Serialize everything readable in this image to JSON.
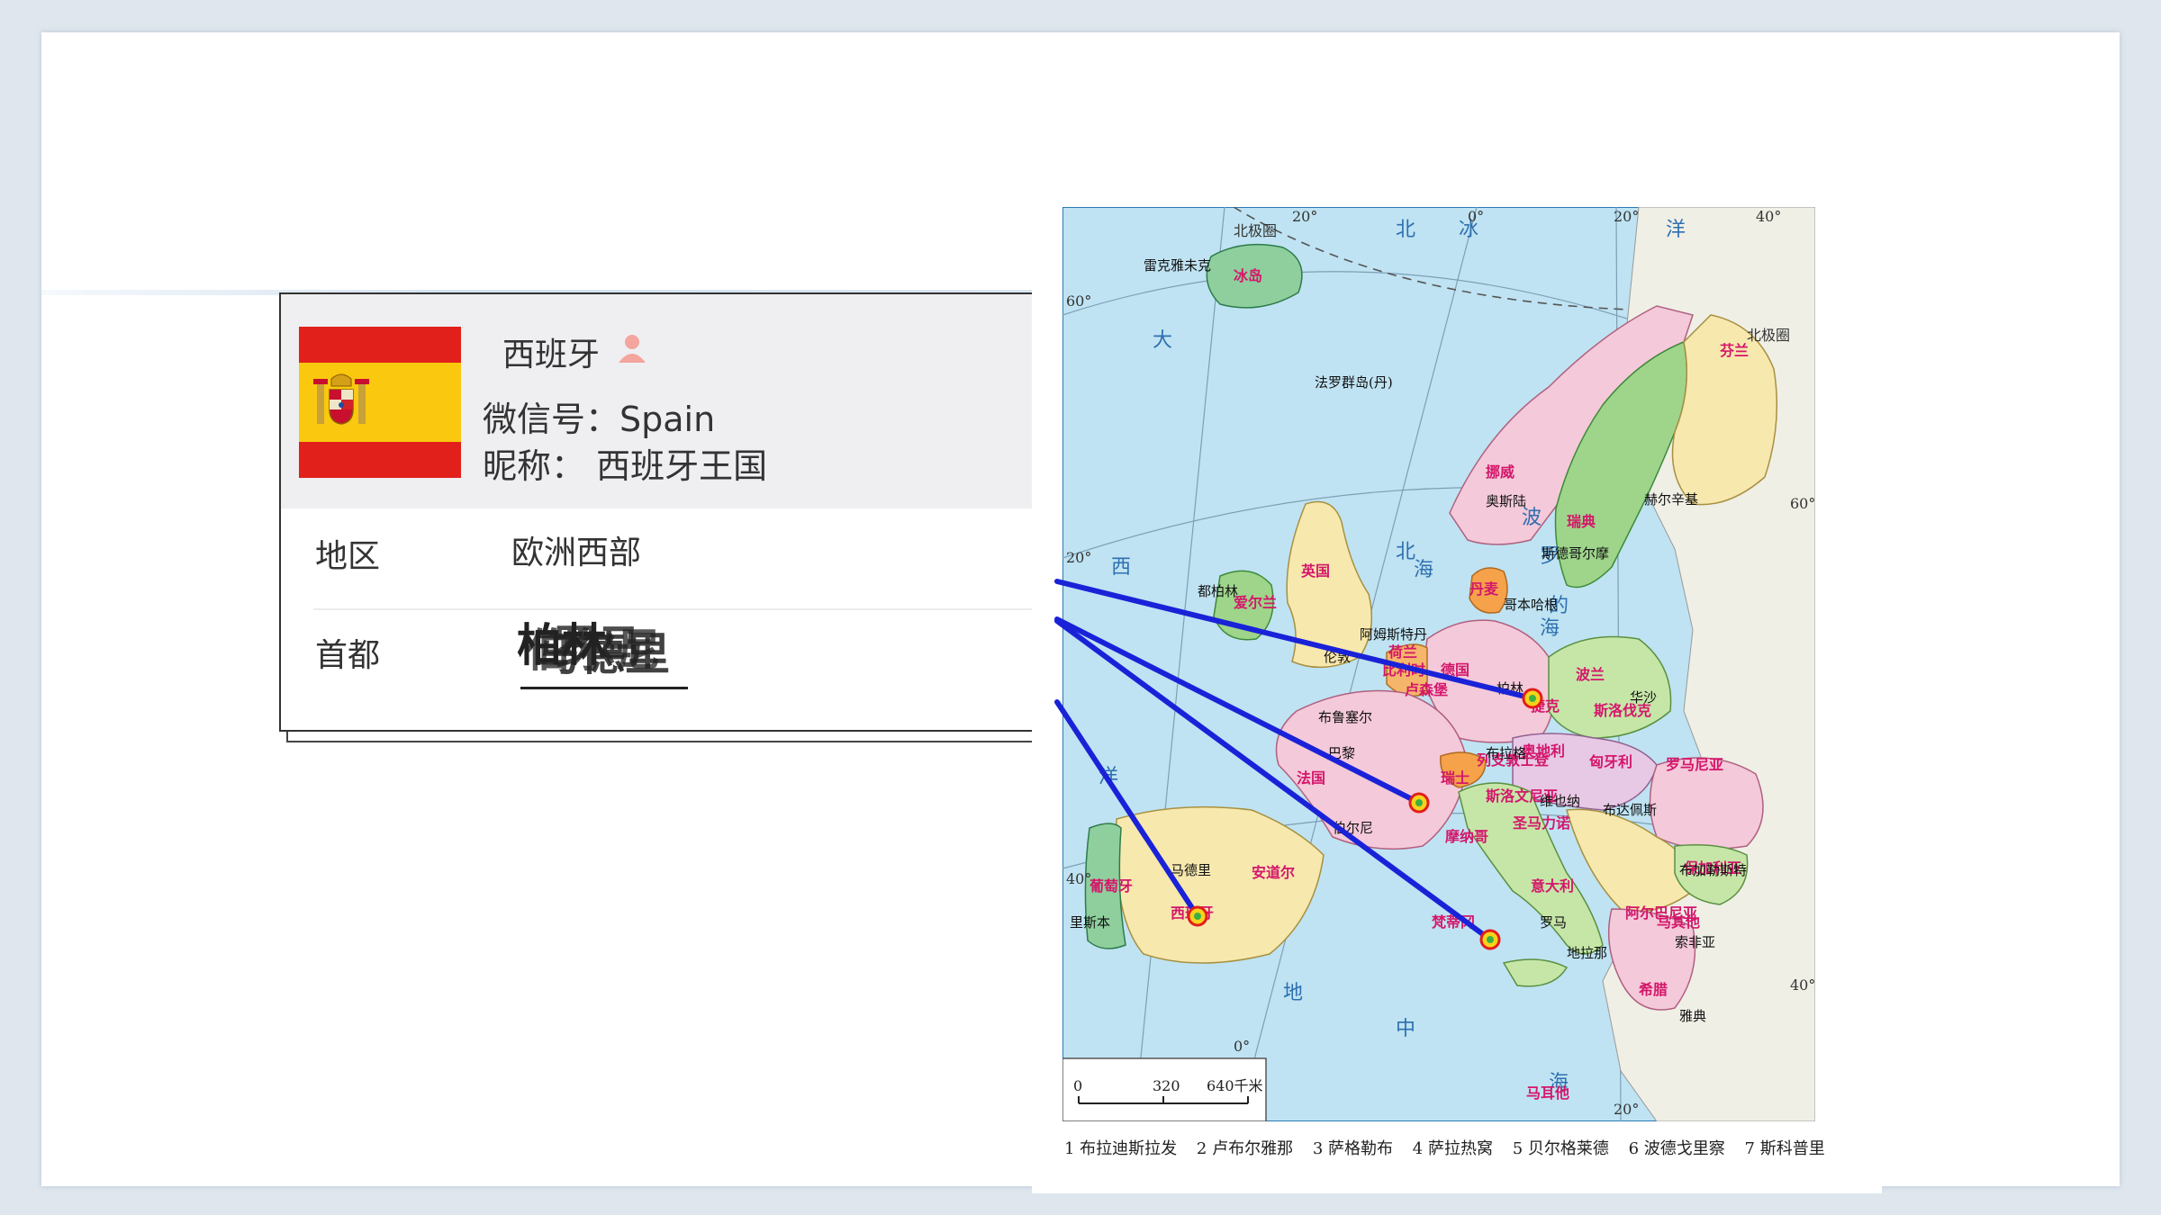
{
  "card": {
    "name": "西班牙",
    "wechat": "微信号：Spain",
    "nickname": "昵称：  西班牙王国",
    "region_label": "地区",
    "region_value": "欧洲西部",
    "capital_label": "首都",
    "capital_overlap": [
      "柏林",
      "马德里",
      "罗马",
      "伯尔尼"
    ],
    "icons": {
      "person": "person-icon",
      "flag": "spain-flag"
    }
  },
  "map": {
    "ocean_labels": [
      "北",
      "冰",
      "洋",
      "大",
      "西",
      "洋",
      "北",
      "海",
      "波",
      "罗",
      "的",
      "海",
      "地",
      "中",
      "海"
    ],
    "lat_labels": [
      "60°",
      "20°",
      "40°",
      "60°",
      "40°"
    ],
    "lon_labels": [
      "20°",
      "0°",
      "20°",
      "40°",
      "0°",
      "20°"
    ],
    "circle_label": "北极圈",
    "countries": [
      "冰岛",
      "挪威",
      "瑞典",
      "芬兰",
      "丹麦",
      "英国",
      "爱尔兰",
      "荷兰",
      "比利时",
      "卢森堡",
      "德国",
      "波兰",
      "捷克",
      "斯洛伐克",
      "奥地利",
      "匈牙利",
      "罗马尼亚",
      "瑞士",
      "法国",
      "意大利",
      "西班牙",
      "葡萄牙",
      "保加利亚",
      "希腊",
      "阿尔巴尼亚",
      "斯洛文尼亚",
      "圣马力诺",
      "摩纳哥",
      "梵蒂冈",
      "安道尔",
      "马其他",
      "列支敦士登",
      "马耳他"
    ],
    "cities": [
      "雷克雅未克",
      "法罗群岛(丹)",
      "奥斯陆",
      "斯德哥尔摩",
      "赫尔辛基",
      "哥本哈根",
      "都柏林",
      "伦敦",
      "阿姆斯特丹",
      "布鲁塞尔",
      "巴黎",
      "柏林",
      "华沙",
      "布拉格",
      "维也纳",
      "布达佩斯",
      "布加勒斯特",
      "伯尔尼",
      "罗马",
      "马德里",
      "里斯本",
      "索非亚",
      "地拉那",
      "雅典"
    ],
    "highlighted": [
      "柏林",
      "伯尔尼",
      "罗马",
      "马德里"
    ],
    "scale": {
      "zero": "0",
      "mid": "320",
      "end": "640千米"
    },
    "legend": [
      "1 布拉迪斯拉发",
      "2 卢布尔雅那",
      "3 萨格勒布",
      "4 萨拉热窝",
      "5 贝尔格莱德",
      "6 波德戈里察",
      "7 斯科普里"
    ]
  },
  "colors": {
    "sea": "#bfe3f2",
    "land_gray": "#efefe6",
    "connector": "#1a22d8",
    "spain_red": "#e2201b",
    "spain_yellow": "#f9c80f"
  }
}
